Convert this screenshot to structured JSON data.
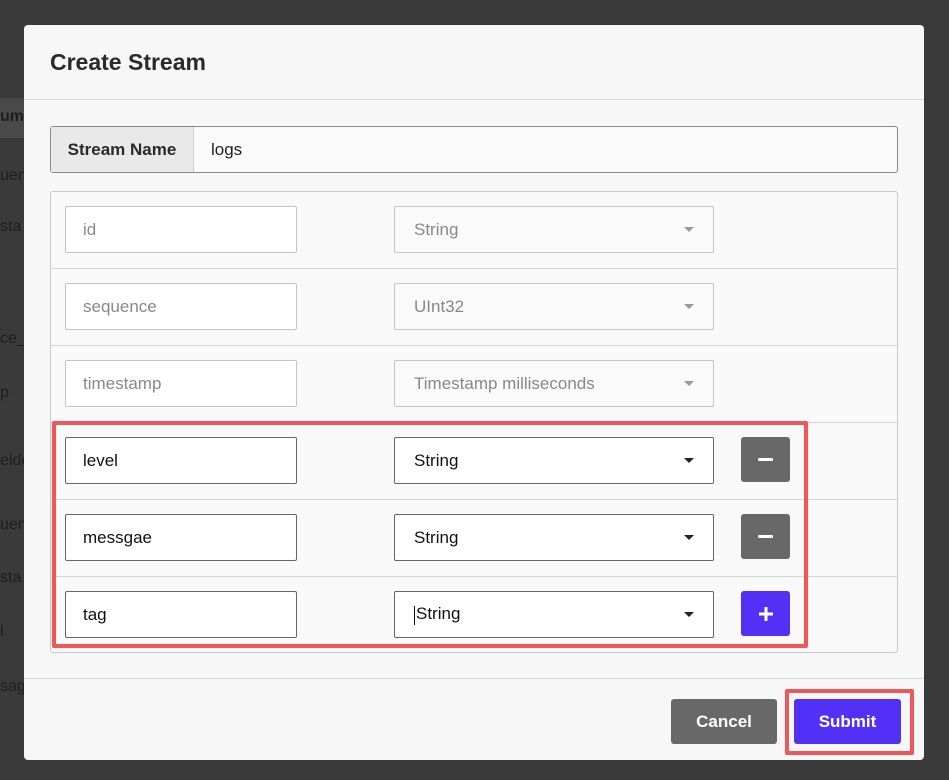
{
  "background": {
    "fragments": [
      "umr",
      "uen",
      "sta",
      "ce_",
      "p",
      "elde",
      "uen",
      "sta",
      "l",
      "sag"
    ]
  },
  "modal": {
    "title": "Create Stream",
    "stream_name": {
      "label": "Stream Name",
      "value": "logs"
    },
    "fields": [
      {
        "name": "id",
        "type": "String",
        "editable": false
      },
      {
        "name": "sequence",
        "type": "UInt32",
        "editable": false
      },
      {
        "name": "timestamp",
        "type": "Timestamp milliseconds",
        "editable": false
      },
      {
        "name": "level",
        "type": "String",
        "editable": true,
        "action": "remove"
      },
      {
        "name": "messgae",
        "type": "String",
        "editable": true,
        "action": "remove"
      },
      {
        "name": "tag",
        "type": "String",
        "editable": true,
        "action": "add"
      }
    ],
    "footer": {
      "cancel_label": "Cancel",
      "submit_label": "Submit"
    }
  },
  "colors": {
    "accent": "#5330f5",
    "secondary_button": "#686868",
    "highlight": "#f0575a"
  },
  "icons": {
    "remove": "minus-icon",
    "add": "plus-icon",
    "dropdown": "chevron-down-icon"
  }
}
